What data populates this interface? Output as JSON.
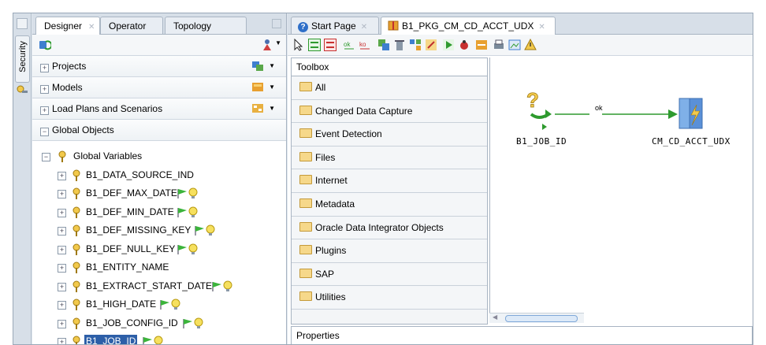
{
  "left_tabs": [
    "Designer",
    "Operator",
    "Topology"
  ],
  "side_tab": "Security",
  "accordions": [
    "Projects",
    "Models",
    "Load Plans and Scenarios",
    "Global Objects"
  ],
  "tree": {
    "root": "Global Variables",
    "items": [
      {
        "label": "B1_DATA_SOURCE_IND",
        "flag": false
      },
      {
        "label": "B1_DEF_MAX_DATE",
        "flag": true
      },
      {
        "label": "B1_DEF_MIN_DATE",
        "flag": true
      },
      {
        "label": "B1_DEF_MISSING_KEY",
        "flag": true
      },
      {
        "label": "B1_DEF_NULL_KEY",
        "flag": true
      },
      {
        "label": "B1_ENTITY_NAME",
        "flag": false
      },
      {
        "label": "B1_EXTRACT_START_DATE",
        "flag": true
      },
      {
        "label": "B1_HIGH_DATE",
        "flag": true
      },
      {
        "label": "B1_JOB_CONFIG_ID",
        "flag": true
      },
      {
        "label": "B1_JOB_ID",
        "flag": true,
        "selected": true
      }
    ]
  },
  "editor_tabs": [
    "Start Page",
    "B1_PKG_CM_CD_ACCT_UDX"
  ],
  "toolbox": {
    "title": "Toolbox",
    "items": [
      "All",
      "Changed Data Capture",
      "Event Detection",
      "Files",
      "Internet",
      "Metadata",
      "Oracle Data Integrator Objects",
      "Plugins",
      "SAP",
      "Utilities"
    ]
  },
  "diagram": {
    "source": "B1_JOB_ID",
    "target": "CM_CD_ACCT_UDX",
    "link": "ok"
  },
  "properties_title": "Properties",
  "colors": {
    "selection": "#2d5fa8",
    "link": "#2e9a2e"
  }
}
